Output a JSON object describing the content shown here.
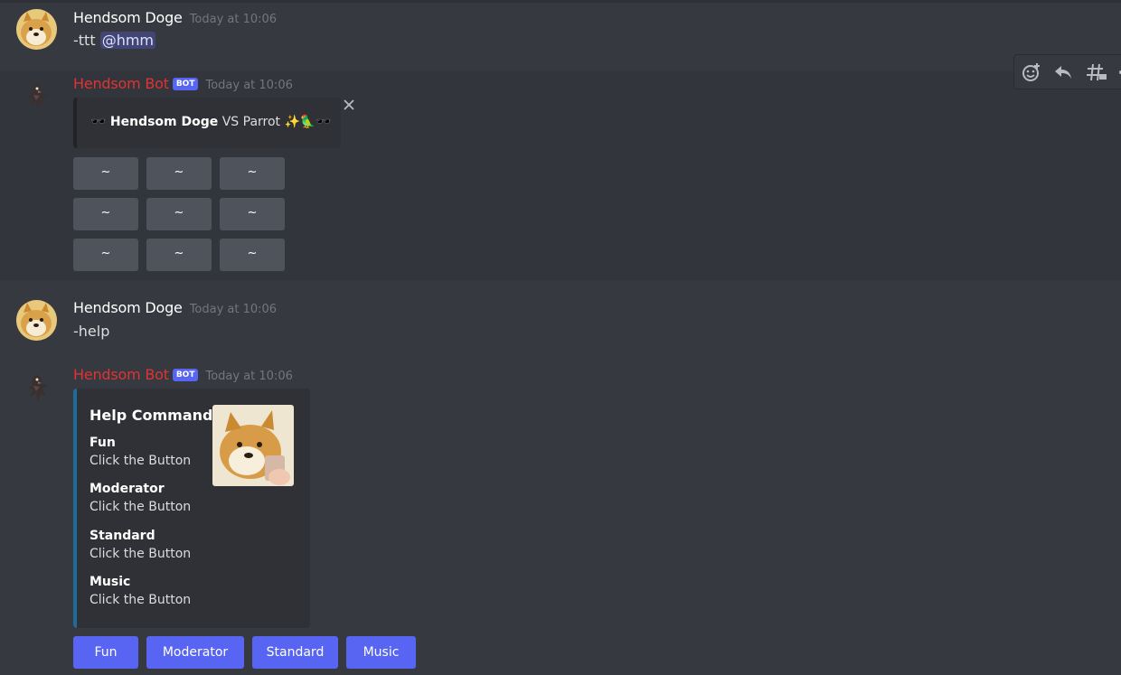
{
  "messages": [
    {
      "author": "Hendsom Doge",
      "timestamp": "Today at 10:06",
      "text": "-ttt",
      "mention": "@hmm"
    },
    {
      "author": "Hendsom Bot",
      "badge": "BOT",
      "timestamp": "Today at 10:06",
      "embed": {
        "emoji_left": "🕶️",
        "player1": "Hendsom Doge",
        "vs_text": "VS Parrot",
        "emoji_right": "✨🦜🕶️"
      },
      "grid": [
        "~",
        "~",
        "~",
        "~",
        "~",
        "~",
        "~",
        "~",
        "~"
      ]
    },
    {
      "author": "Hendsom Doge",
      "timestamp": "Today at 10:06",
      "text": "-help"
    },
    {
      "author": "Hendsom Bot",
      "badge": "BOT",
      "timestamp": "Today at 10:06",
      "embed": {
        "title": "Help Command",
        "fields": [
          {
            "name": "Fun",
            "value": "Click the Button"
          },
          {
            "name": "Moderator",
            "value": "Click the Button"
          },
          {
            "name": "Standard",
            "value": "Click the Button"
          },
          {
            "name": "Music",
            "value": "Click the Button"
          }
        ]
      },
      "buttons": [
        "Fun",
        "Moderator",
        "Standard",
        "Music"
      ]
    }
  ],
  "toolbar": {
    "icons": [
      "add-reaction-icon",
      "reply-icon",
      "create-thread-icon",
      "more-icon"
    ]
  },
  "colors": {
    "background": "#36393f",
    "bot_name": "#e03333",
    "blurple": "#5865f2",
    "grey_button": "#4f545c",
    "embed_accent": "#1f6b9a"
  }
}
